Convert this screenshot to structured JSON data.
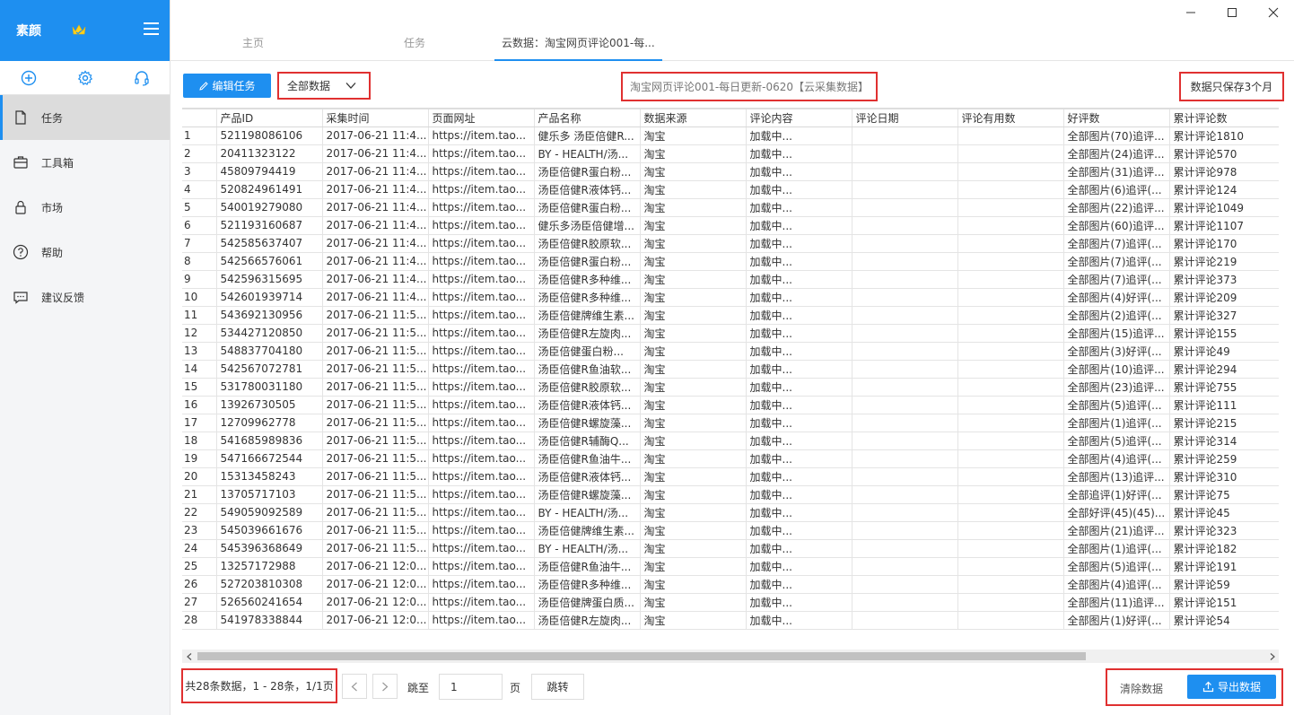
{
  "app": {
    "name": "素颜"
  },
  "sidebar": {
    "items": [
      {
        "label": "任务",
        "icon": "document-icon",
        "active": true
      },
      {
        "label": "工具箱",
        "icon": "toolbox-icon"
      },
      {
        "label": "市场",
        "icon": "lock-icon"
      },
      {
        "label": "帮助",
        "icon": "help-icon"
      },
      {
        "label": "建议反馈",
        "icon": "feedback-icon"
      }
    ]
  },
  "tabs": [
    {
      "label": "主页"
    },
    {
      "label": "任务"
    },
    {
      "label": "云数据：淘宝网页评论001-每..."
    }
  ],
  "toolbar": {
    "edit_label": "编辑任务",
    "filter_value": "全部数据",
    "task_title": "淘宝网页评论001-每日更新-0620【云采集数据】",
    "retention_note": "数据只保存3个月"
  },
  "table": {
    "columns": [
      "",
      "产品ID",
      "采集时间",
      "页面网址",
      "产品名称",
      "数据来源",
      "评论内容",
      "评论日期",
      "评论有用数",
      "好评数",
      "累计评论数"
    ],
    "rows": [
      [
        "1",
        "521198086106",
        "2017-06-21  11:4...",
        "https://item.tao...",
        "健乐多 汤臣倍健R...",
        "淘宝",
        "加载中...",
        "",
        "",
        "全部图片(70)追评...",
        "累计评论1810"
      ],
      [
        "2",
        "20411323122",
        "2017-06-21  11:4...",
        "https://item.tao...",
        "BY - HEALTH/汤...",
        "淘宝",
        "加载中...",
        "",
        "",
        "全部图片(24)追评...",
        "累计评论570"
      ],
      [
        "3",
        "45809794419",
        "2017-06-21  11:4...",
        "https://item.tao...",
        "汤臣倍健R蛋白粉...",
        "淘宝",
        "加载中...",
        "",
        "",
        "全部图片(31)追评...",
        "累计评论978"
      ],
      [
        "4",
        "520824961491",
        "2017-06-21  11:4...",
        "https://item.tao...",
        "汤臣倍健R液体钙...",
        "淘宝",
        "加载中...",
        "",
        "",
        "全部图片(6)追评(...",
        "累计评论124"
      ],
      [
        "5",
        "540019279080",
        "2017-06-21  11:4...",
        "https://item.tao...",
        "汤臣倍健R蛋白粉...",
        "淘宝",
        "加载中...",
        "",
        "",
        "全部图片(22)追评...",
        "累计评论1049"
      ],
      [
        "6",
        "521193160687",
        "2017-06-21  11:4...",
        "https://item.tao...",
        "健乐多汤臣倍健增...",
        "淘宝",
        "加载中...",
        "",
        "",
        "全部图片(60)追评...",
        "累计评论1107"
      ],
      [
        "7",
        "542585637407",
        "2017-06-21  11:4...",
        "https://item.tao...",
        "汤臣倍健R胶原软...",
        "淘宝",
        "加载中...",
        "",
        "",
        "全部图片(7)追评(...",
        "累计评论170"
      ],
      [
        "8",
        "542566576061",
        "2017-06-21  11:4...",
        "https://item.tao...",
        "汤臣倍健R蛋白粉...",
        "淘宝",
        "加载中...",
        "",
        "",
        "全部图片(7)追评(...",
        "累计评论219"
      ],
      [
        "9",
        "542596315695",
        "2017-06-21  11:4...",
        "https://item.tao...",
        "汤臣倍健R多种维...",
        "淘宝",
        "加载中...",
        "",
        "",
        "全部图片(7)追评(...",
        "累计评论373"
      ],
      [
        "10",
        "542601939714",
        "2017-06-21  11:4...",
        "https://item.tao...",
        "汤臣倍健R多种维...",
        "淘宝",
        "加载中...",
        "",
        "",
        "全部图片(4)好评(...",
        "累计评论209"
      ],
      [
        "11",
        "543692130956",
        "2017-06-21  11:5...",
        "https://item.tao...",
        "汤臣倍健牌维生素...",
        "淘宝",
        "加载中...",
        "",
        "",
        "全部图片(2)追评(...",
        "累计评论327"
      ],
      [
        "12",
        "534427120850",
        "2017-06-21  11:5...",
        "https://item.tao...",
        "汤臣倍健R左旋肉...",
        "淘宝",
        "加载中...",
        "",
        "",
        "全部图片(15)追评...",
        "累计评论155"
      ],
      [
        "13",
        "548837704180",
        "2017-06-21  11:5...",
        "https://item.tao...",
        "汤臣倍健蛋白粉...",
        "淘宝",
        "加载中...",
        "",
        "",
        "全部图片(3)好评(...",
        "累计评论49"
      ],
      [
        "14",
        "542567072781",
        "2017-06-21  11:5...",
        "https://item.tao...",
        "汤臣倍健R鱼油软...",
        "淘宝",
        "加载中...",
        "",
        "",
        "全部图片(10)追评...",
        "累计评论294"
      ],
      [
        "15",
        "531780031180",
        "2017-06-21  11:5...",
        "https://item.tao...",
        "汤臣倍健R胶原软...",
        "淘宝",
        "加载中...",
        "",
        "",
        "全部图片(23)追评...",
        "累计评论755"
      ],
      [
        "16",
        "13926730505",
        "2017-06-21  11:5...",
        "https://item.tao...",
        "汤臣倍健R液体钙...",
        "淘宝",
        "加载中...",
        "",
        "",
        "全部图片(5)追评(...",
        "累计评论111"
      ],
      [
        "17",
        "12709962778",
        "2017-06-21  11:5...",
        "https://item.tao...",
        "汤臣倍健R螺旋藻...",
        "淘宝",
        "加载中...",
        "",
        "",
        "全部图片(1)追评(...",
        "累计评论215"
      ],
      [
        "18",
        "541685989836",
        "2017-06-21  11:5...",
        "https://item.tao...",
        "汤臣倍健R辅酶Q...",
        "淘宝",
        "加载中...",
        "",
        "",
        "全部图片(5)追评(...",
        "累计评论314"
      ],
      [
        "19",
        "547166672544",
        "2017-06-21  11:5...",
        "https://item.tao...",
        "汤臣倍健R鱼油牛...",
        "淘宝",
        "加载中...",
        "",
        "",
        "全部图片(4)追评(...",
        "累计评论259"
      ],
      [
        "20",
        "15313458243",
        "2017-06-21  11:5...",
        "https://item.tao...",
        "汤臣倍健R液体钙...",
        "淘宝",
        "加载中...",
        "",
        "",
        "全部图片(13)追评...",
        "累计评论310"
      ],
      [
        "21",
        "13705717103",
        "2017-06-21  11:5...",
        "https://item.tao...",
        "汤臣倍健R螺旋藻...",
        "淘宝",
        "加载中...",
        "",
        "",
        "全部追评(1)好评(...",
        "累计评论75"
      ],
      [
        "22",
        "549059092589",
        "2017-06-21  11:5...",
        "https://item.tao...",
        "BY - HEALTH/汤...",
        "淘宝",
        "加载中...",
        "",
        "",
        "全部好评(45)(45)...",
        "累计评论45"
      ],
      [
        "23",
        "545039661676",
        "2017-06-21  11:5...",
        "https://item.tao...",
        "汤臣倍健牌维生素...",
        "淘宝",
        "加载中...",
        "",
        "",
        "全部图片(21)追评...",
        "累计评论323"
      ],
      [
        "24",
        "545396368649",
        "2017-06-21  11:5...",
        "https://item.tao...",
        "BY - HEALTH/汤...",
        "淘宝",
        "加载中...",
        "",
        "",
        "全部图片(1)追评(...",
        "累计评论182"
      ],
      [
        "25",
        "13257172988",
        "2017-06-21  12:0...",
        "https://item.tao...",
        "汤臣倍健R鱼油牛...",
        "淘宝",
        "加载中...",
        "",
        "",
        "全部图片(5)追评(...",
        "累计评论191"
      ],
      [
        "26",
        "527203810308",
        "2017-06-21  12:0...",
        "https://item.tao...",
        "汤臣倍健R多种维...",
        "淘宝",
        "加载中...",
        "",
        "",
        "全部图片(4)追评(...",
        "累计评论59"
      ],
      [
        "27",
        "526560241654",
        "2017-06-21  12:0...",
        "https://item.tao...",
        "汤臣倍健牌蛋白质...",
        "淘宝",
        "加载中...",
        "",
        "",
        "全部图片(11)追评...",
        "累计评论151"
      ],
      [
        "28",
        "541978338844",
        "2017-06-21  12:0...",
        "https://item.tao...",
        "汤臣倍健R左旋肉...",
        "淘宝",
        "加载中...",
        "",
        "",
        "全部图片(1)好评(...",
        "累计评论54"
      ]
    ]
  },
  "footer": {
    "page_info": "共28条数据，1 - 28条，1/1页",
    "jump_label": "跳至",
    "page_input": "1",
    "page_unit": "页",
    "jump_button": "跳转",
    "clear_label": "清除数据",
    "export_label": "导出数据"
  },
  "colors": {
    "accent": "#1e8ff0",
    "highlight_border": "#e03030",
    "sidebar_active": "#dcdcdc"
  }
}
